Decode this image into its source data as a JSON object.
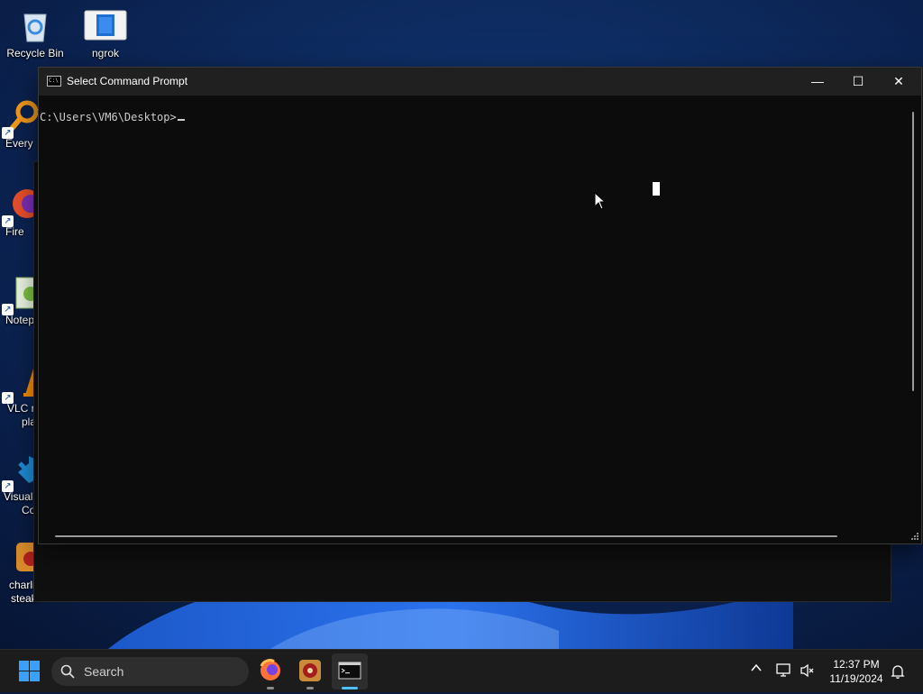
{
  "desktop": {
    "icons": [
      {
        "label": "Recycle Bin"
      },
      {
        "label": "ngrok"
      },
      {
        "label": "Every"
      },
      {
        "label": "Fire"
      },
      {
        "label": "Notep"
      },
      {
        "label": "VLC r",
        "label2": "pla"
      },
      {
        "label": "Visual",
        "label2": "Co"
      },
      {
        "label": "charli",
        "label2": "steak"
      }
    ]
  },
  "window": {
    "title": "Select Command Prompt",
    "prompt": "C:\\Users\\VM6\\Desktop>",
    "controls": {
      "minimize": "—",
      "maximize": "☐",
      "close": "✕"
    }
  },
  "taskbar": {
    "search_placeholder": "Search",
    "apps": [
      "firefox-icon",
      "game-icon",
      "terminal-icon"
    ],
    "tray": {
      "chevron": "^"
    },
    "clock": {
      "time": "12:37 PM",
      "date": "11/19/2024"
    }
  },
  "colors": {
    "console_bg": "#0c0c0c",
    "console_text": "#cccccc",
    "titlebar_bg": "#202020",
    "taskbar_bg": "#1c1c1c",
    "accent": "#4cc2ff"
  }
}
